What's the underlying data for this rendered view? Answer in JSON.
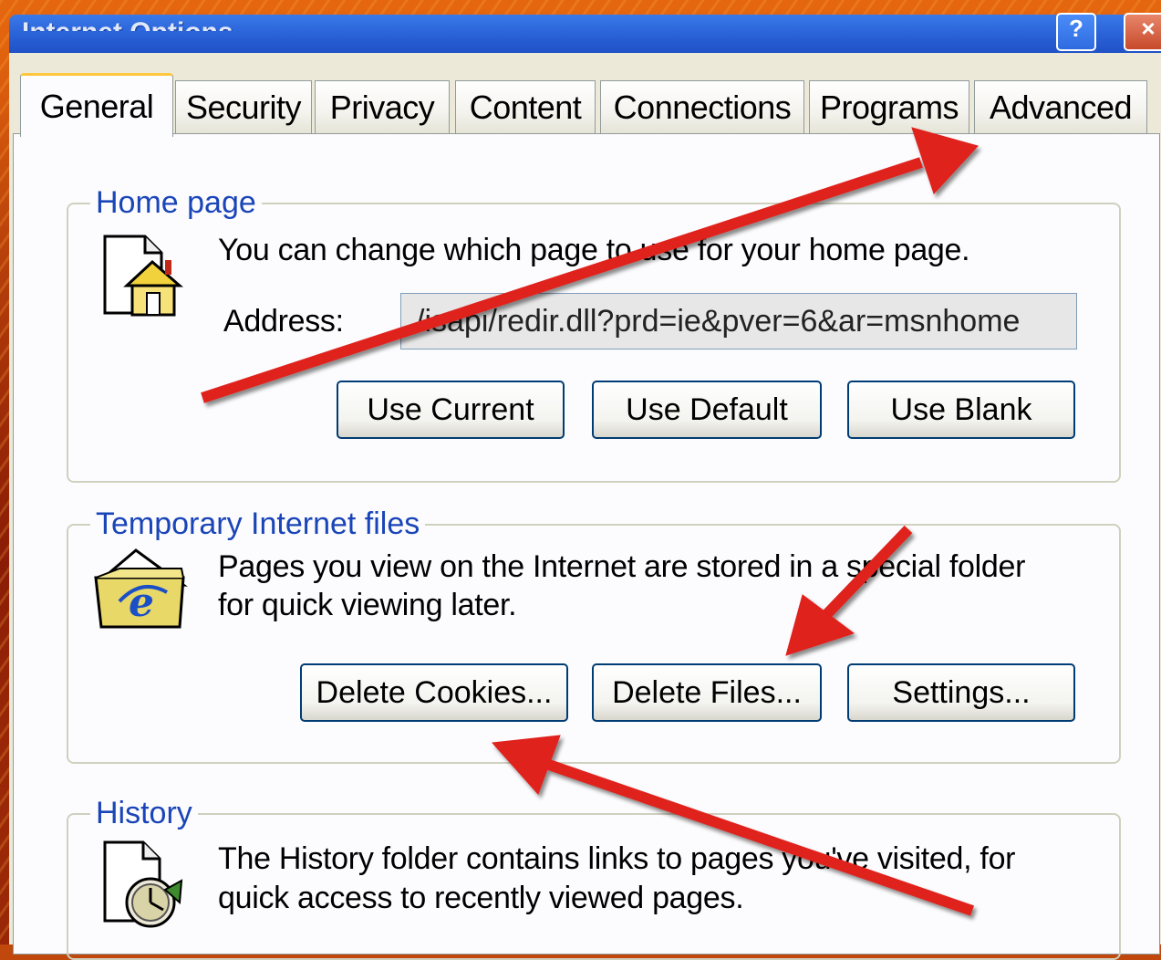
{
  "window": {
    "title": "Internet Options",
    "help_button": "?",
    "close_button": "×"
  },
  "tabs": [
    {
      "label": "General",
      "active": true
    },
    {
      "label": "Security",
      "active": false
    },
    {
      "label": "Privacy",
      "active": false
    },
    {
      "label": "Content",
      "active": false
    },
    {
      "label": "Connections",
      "active": false
    },
    {
      "label": "Programs",
      "active": false
    },
    {
      "label": "Advanced",
      "active": false
    }
  ],
  "home_page": {
    "legend": "Home page",
    "description": "You can change which page to use for your home page.",
    "address_label": "Address:",
    "address_value": "/isapi/redir.dll?prd=ie&pver=6&ar=msnhome",
    "use_current": "Use Current",
    "use_default": "Use Default",
    "use_blank": "Use Blank",
    "icon": "home-page-icon"
  },
  "temp_files": {
    "legend": "Temporary Internet files",
    "description_line1": "Pages you view on the Internet are stored in a special folder",
    "description_line2": "for quick viewing later.",
    "delete_cookies": "Delete Cookies...",
    "delete_files": "Delete Files...",
    "settings": "Settings...",
    "icon": "ie-folder-icon"
  },
  "history": {
    "legend": "History",
    "description_line1": "The History folder contains links to pages you've visited, for",
    "description_line2": "quick access to recently viewed pages.",
    "icon": "history-clock-icon"
  },
  "annotation_color": "#e0201c"
}
